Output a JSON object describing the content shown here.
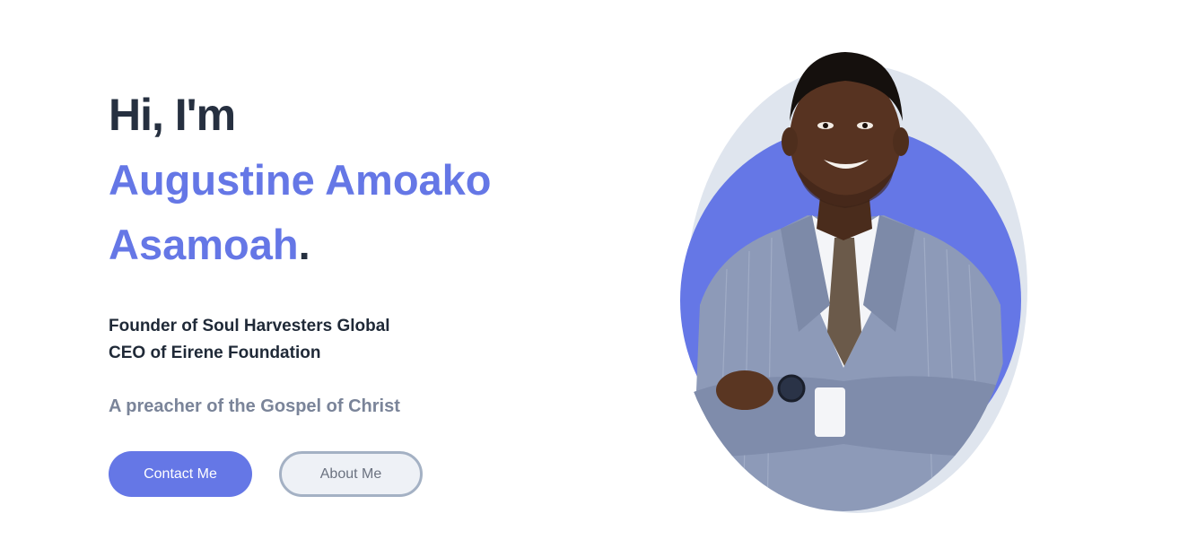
{
  "hero": {
    "greeting": "Hi, I'm",
    "name_line1": "Augustine Amoako",
    "name_line2": "Asamoah",
    "name_end": ".",
    "roles": [
      "Founder of Soul Harvesters Global",
      "CEO of Eirene Foundation"
    ],
    "tagline": "A preacher of the Gospel of Christ",
    "contact_label": "Contact Me",
    "about_label": "About Me"
  },
  "colors": {
    "accent": "#6577e6",
    "heading": "#263040",
    "muted": "#7a8499",
    "blob_shadow": "#dfe5ee"
  }
}
